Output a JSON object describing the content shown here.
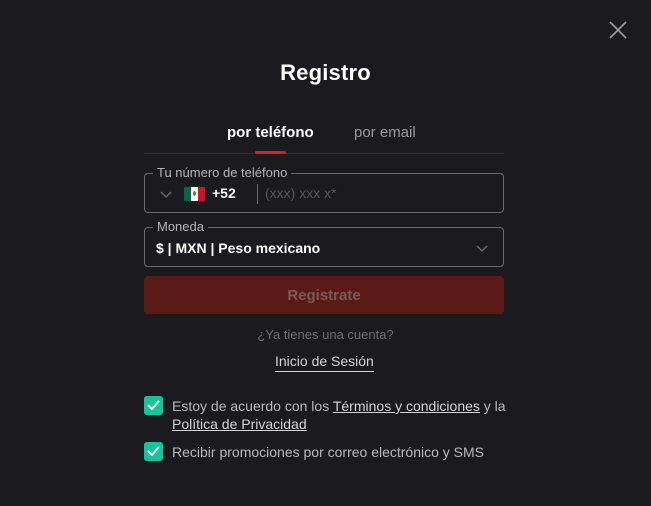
{
  "modal": {
    "title": "Registro"
  },
  "tabs": [
    {
      "label": "por teléfono",
      "active": true
    },
    {
      "label": "por email",
      "active": false
    }
  ],
  "phone_field": {
    "legend": "Tu número de teléfono",
    "country": "MX",
    "dial_code": "+52",
    "placeholder": "(xxx) xxx x*",
    "value": ""
  },
  "currency_field": {
    "legend": "Moneda",
    "selected": "$ | MXN | Peso mexicano"
  },
  "submit": {
    "label": "Registrate",
    "enabled": false
  },
  "account": {
    "question": "¿Ya tienes una cuenta?",
    "login_label": "Inicio de Sesión"
  },
  "consents": {
    "terms": {
      "checked": true,
      "prefix": "Estoy de acuerdo con los ",
      "terms_link": "Términos y condiciones",
      "middle": " y la ",
      "privacy_link": "Política de Privacidad"
    },
    "promos": {
      "checked": true,
      "label": "Recibir promociones por correo electrónico y SMS"
    }
  },
  "colors": {
    "background": "#1b1b1f",
    "accent_red": "#e01f25",
    "button_disabled": "#5a1a17",
    "checkbox": "#16c39a"
  },
  "icons": [
    "close-icon",
    "chevron-down-icon",
    "mexico-flag-icon",
    "checkmark-icon"
  ]
}
